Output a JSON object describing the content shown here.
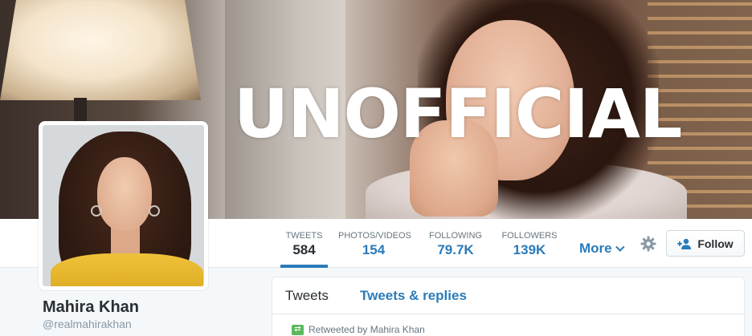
{
  "banner": {
    "overlay_text": "UNOFFICIAL"
  },
  "profile": {
    "name": "Mahira Khan",
    "handle": "@realmahirakhan"
  },
  "nav": {
    "stats": [
      {
        "label": "TWEETS",
        "value": "584",
        "active": true
      },
      {
        "label": "PHOTOS/VIDEOS",
        "value": "154",
        "active": false
      },
      {
        "label": "FOLLOWING",
        "value": "79.7K",
        "active": false
      },
      {
        "label": "FOLLOWERS",
        "value": "139K",
        "active": false
      }
    ],
    "more_label": "More",
    "follow_label": "Follow"
  },
  "timeline": {
    "tabs": [
      {
        "label": "Tweets"
      },
      {
        "label": "Tweets & replies"
      }
    ],
    "retweet_text": "Retweeted by Mahira Khan"
  },
  "colors": {
    "accent": "#2b7bb9",
    "text": "#292f33",
    "muted": "#66757f",
    "retweet": "#5cb85c"
  },
  "icons": [
    "gear-icon",
    "add-user-icon",
    "chevron-down-icon",
    "retweet-icon"
  ]
}
